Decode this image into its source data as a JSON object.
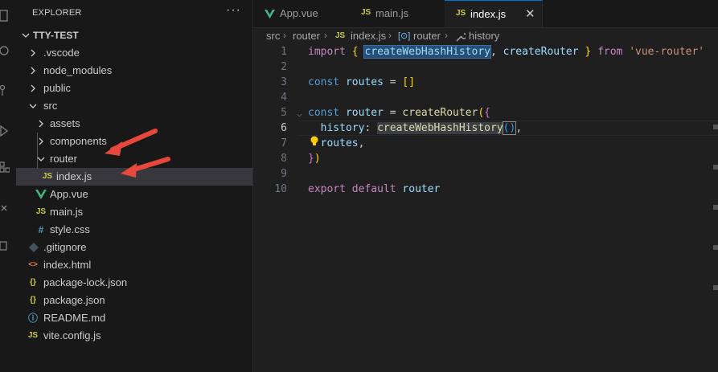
{
  "sidebar": {
    "title": "EXPLORER",
    "more": "···",
    "root": "TTY-TEST",
    "items": [
      {
        "label": ".vscode",
        "kind": "folder",
        "icon": "chevron-right-icon"
      },
      {
        "label": "node_modules",
        "kind": "folder",
        "icon": "chevron-right-icon"
      },
      {
        "label": "public",
        "kind": "folder",
        "icon": "chevron-right-icon"
      },
      {
        "label": "src",
        "kind": "folder-open",
        "icon": "chevron-down-icon"
      },
      {
        "label": "assets",
        "kind": "folder",
        "icon": "chevron-right-icon"
      },
      {
        "label": "components",
        "kind": "folder",
        "icon": "chevron-right-icon"
      },
      {
        "label": "router",
        "kind": "folder-open",
        "icon": "chevron-down-icon"
      },
      {
        "label": "index.js",
        "kind": "js",
        "icon_text": "JS"
      },
      {
        "label": "App.vue",
        "kind": "vue",
        "icon": "vue-icon"
      },
      {
        "label": "main.js",
        "kind": "js",
        "icon_text": "JS"
      },
      {
        "label": "style.css",
        "kind": "css",
        "icon_text": "#"
      },
      {
        "label": ".gitignore",
        "kind": "git",
        "icon": "git-icon"
      },
      {
        "label": "index.html",
        "kind": "html",
        "icon_text": "<>"
      },
      {
        "label": "package-lock.json",
        "kind": "json",
        "icon_text": "{}"
      },
      {
        "label": "package.json",
        "kind": "json",
        "icon_text": "{}"
      },
      {
        "label": "README.md",
        "kind": "info",
        "icon_text": "ⓘ"
      },
      {
        "label": "vite.config.js",
        "kind": "js",
        "icon_text": "JS"
      }
    ]
  },
  "tabs": [
    {
      "label": "App.vue",
      "icon": "vue-icon"
    },
    {
      "label": "main.js",
      "icon_text": "JS"
    },
    {
      "label": "index.js",
      "icon_text": "JS",
      "close": "✕"
    }
  ],
  "breadcrumb": {
    "parts": [
      "src",
      "router",
      "index.js",
      "router",
      "history"
    ],
    "js_icon": "JS",
    "var_icon": "[⊙]"
  },
  "editor": {
    "line_numbers": [
      "1",
      "2",
      "3",
      "4",
      "5",
      "6",
      "7",
      "8",
      "9",
      "10"
    ],
    "current_line": 6,
    "colors": {
      "keyword": "#569cd6",
      "control_keyword": "#c586c0",
      "identifier": "#9cdcfe",
      "function": "#dcdcaa",
      "string": "#ce9178",
      "bracket_1": "#ffd700",
      "bracket_2": "#da70d6"
    },
    "tokens": {
      "import": "import",
      "create_hash": "createWebHashHistory",
      "create_router": "createRouter",
      "from": "from",
      "vue_router": "'vue-router'",
      "const": "const",
      "routes": "routes",
      "router": "router",
      "history_key": "history",
      "export": "export",
      "default": "default"
    }
  },
  "theme": {
    "accent": "#0078d4",
    "annotation_arrow": "#e8473b"
  }
}
